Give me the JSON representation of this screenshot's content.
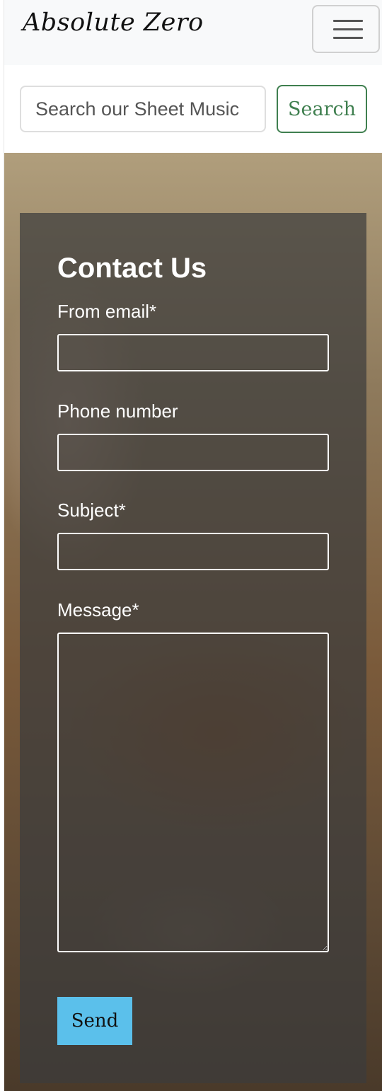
{
  "navbar": {
    "brand": "Absolute Zero",
    "toggler_icon": "hamburger-menu-icon"
  },
  "search": {
    "placeholder": "Search our Sheet Music",
    "button_label": "Search",
    "accent_color": "#3f7f4f"
  },
  "hero": {
    "background_description_color": "#8e7a5c"
  },
  "contact": {
    "title": "Contact Us",
    "fields": {
      "email_label": "From email*",
      "phone_label": "Phone number",
      "subject_label": "Subject*",
      "message_label": "Message*"
    },
    "send_label": "Send",
    "send_color": "#5bc0eb"
  }
}
